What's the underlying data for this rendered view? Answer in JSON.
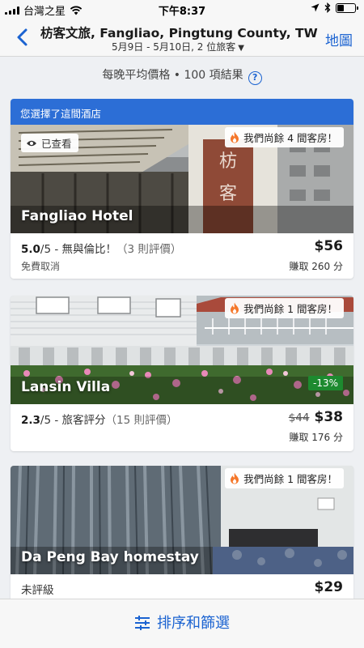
{
  "status_bar": {
    "carrier": "台灣之星",
    "time": "下午8:37"
  },
  "header": {
    "title": "枋客文旅, Fangliao, Pingtung County, TW",
    "subtitle": "5月9日 - 5月10日, 2 位旅客",
    "map_label": "地圖"
  },
  "results_info": {
    "text": "每晚平均價格 • 100 項結果"
  },
  "hotels": [
    {
      "selected_banner": "您選擇了這間酒店",
      "viewed_label": "已查看",
      "rooms_left": "我們尚餘 4 間客房！",
      "name": "Fangliao Hotel",
      "rating_score": "5.0",
      "rating_text": "/5 - 無與倫比！",
      "reviews": "（3 則評價）",
      "sub_text": "免費取消",
      "price": "$56",
      "earn": "賺取 260 分"
    },
    {
      "rooms_left": "我們尚餘 1 間客房！",
      "name": "Lansin Villa",
      "discount": "-13%",
      "rating_score": "2.3",
      "rating_text": "/5 - 旅客評分",
      "reviews": "（15 則評價）",
      "old_price": "$44",
      "price": "$38",
      "earn": "賺取 176 分"
    },
    {
      "rooms_left": "我們尚餘 1 間客房！",
      "name": "Da Peng Bay homestay",
      "rating_text": "未評級",
      "price": "$29"
    }
  ],
  "bottom_bar": {
    "sort_label": "排序和篩選"
  },
  "colors": {
    "accent": "#1b63d1",
    "banner": "#2c6ed6",
    "discount": "#1d8a2f",
    "flame": "#f5772a"
  }
}
